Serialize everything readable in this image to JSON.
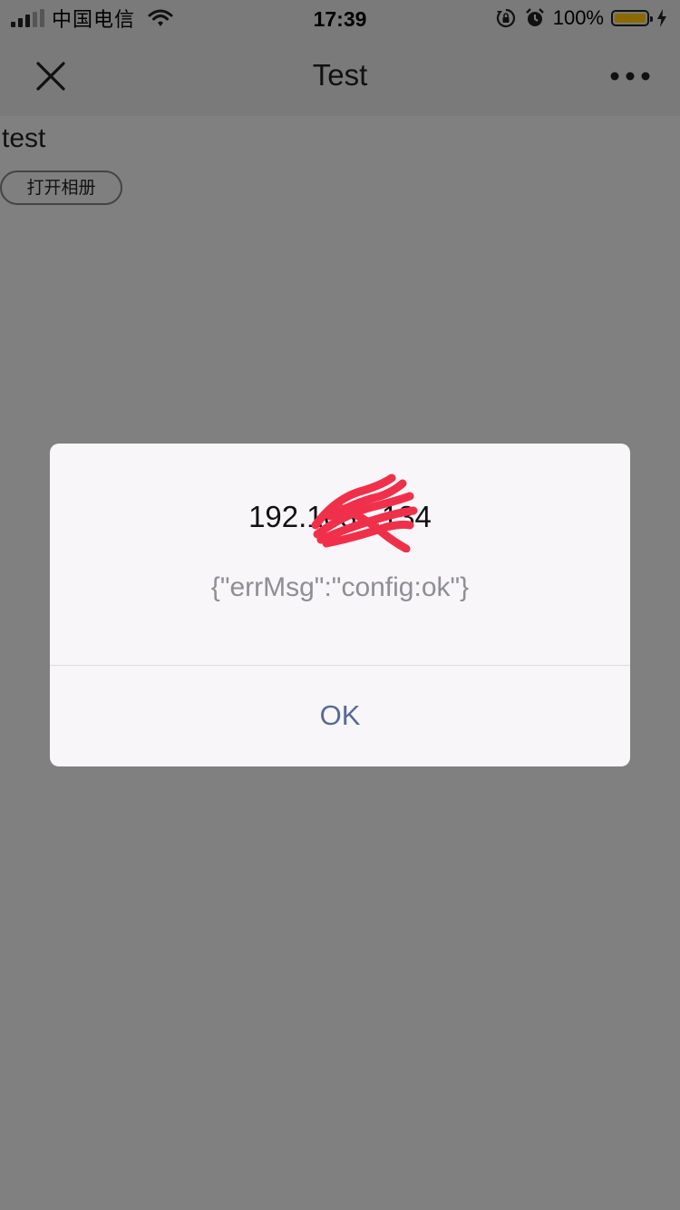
{
  "status_bar": {
    "carrier": "中国电信",
    "time": "17:39",
    "battery_percent": "100%",
    "battery_level": 1.0,
    "signal_bars_filled": 3,
    "signal_bars_total": 5,
    "icons": [
      "signal-icon",
      "wifi-icon",
      "orientation-lock-icon",
      "alarm-icon",
      "battery-icon",
      "charging-bolt-icon"
    ]
  },
  "nav": {
    "title": "Test",
    "close_icon": "close-icon",
    "more_icon": "more-icon"
  },
  "content": {
    "text": "test",
    "button_label": "打开相册"
  },
  "dialog": {
    "title": "192.168.  .134",
    "message": "{\"errMsg\":\"config:ok\"}",
    "ok_label": "OK",
    "colors": {
      "ok_text": "#576b95",
      "message_text": "#8e8e93",
      "redaction": "#f0304a"
    }
  }
}
